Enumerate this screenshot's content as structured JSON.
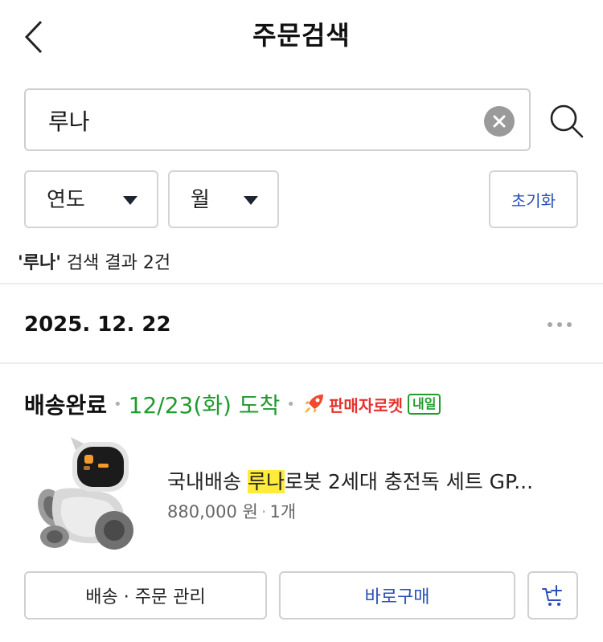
{
  "header": {
    "title": "주문검색"
  },
  "search": {
    "value": "루나"
  },
  "filters": {
    "year_label": "연도",
    "month_label": "월",
    "reset_label": "초기화"
  },
  "result_summary": {
    "query": "'루나'",
    "text": " 검색 결과 2건"
  },
  "order": {
    "date": "2025. 12. 22",
    "status": "배송완료",
    "arrival": "12/23(화) 도착",
    "delivery_type": "판매자로켓",
    "delivery_badge": "내일",
    "product": {
      "name_prefix": "국내배송 ",
      "name_highlight": "루나",
      "name_suffix": "로봇 2세대 충전독 세트 GP...",
      "price": "880,000 원",
      "quantity": "1개"
    },
    "actions": {
      "manage_label": "배송 · 주문 관리",
      "buy_label": "바로구매"
    }
  },
  "icons": {
    "back": "chevron-left-icon",
    "clear": "clear-circle-icon",
    "search": "search-icon",
    "dropdown": "caret-down-icon",
    "more": "more-horizontal-icon",
    "rocket": "rocket-icon",
    "cart_add": "cart-add-icon"
  },
  "colors": {
    "arrival_green": "#1f9b2f",
    "rocket_red": "#e5322d",
    "link_blue": "#2a4fb8",
    "highlight": "#ffeb3b"
  }
}
